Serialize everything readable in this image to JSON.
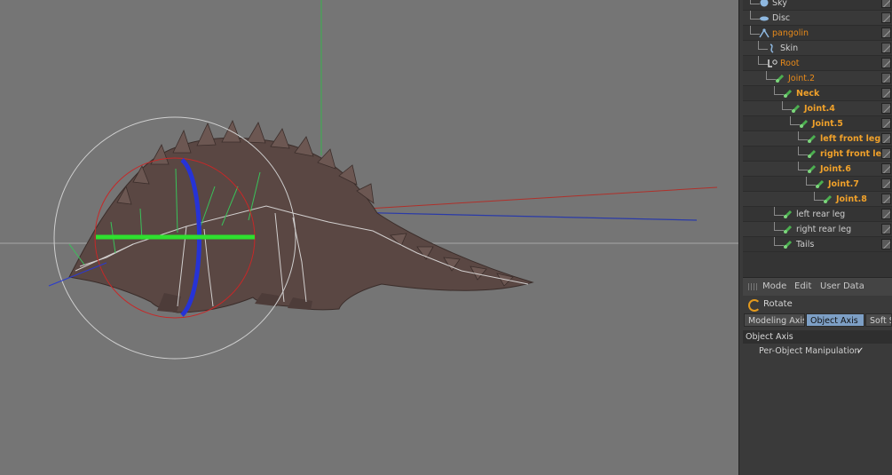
{
  "object_manager": {
    "items": [
      {
        "label": "Sky",
        "icon": "sky-icon",
        "style": "normal",
        "indent": 0
      },
      {
        "label": "Disc",
        "icon": "disc-icon",
        "style": "normal",
        "indent": 0
      },
      {
        "label": "pangolin",
        "icon": "figure-icon",
        "style": "orange",
        "indent": 0
      },
      {
        "label": "Skin",
        "icon": "skin-icon",
        "style": "normal",
        "indent": 1
      },
      {
        "label": "Root",
        "icon": "root-joint-icon",
        "style": "orange",
        "indent": 1
      },
      {
        "label": "Joint.2",
        "icon": "joint-icon",
        "style": "orange",
        "indent": 2
      },
      {
        "label": "Neck",
        "icon": "joint-icon",
        "style": "orange-bold",
        "indent": 3
      },
      {
        "label": "Joint.4",
        "icon": "joint-icon",
        "style": "orange-bold",
        "indent": 4
      },
      {
        "label": "Joint.5",
        "icon": "joint-icon",
        "style": "orange-bold",
        "indent": 5
      },
      {
        "label": "left front leg",
        "icon": "joint-icon",
        "style": "orange-bold",
        "indent": 6
      },
      {
        "label": "right front leg",
        "icon": "joint-icon",
        "style": "orange-bold",
        "indent": 6
      },
      {
        "label": "Joint.6",
        "icon": "joint-icon",
        "style": "orange-bold",
        "indent": 6
      },
      {
        "label": "Joint.7",
        "icon": "joint-icon",
        "style": "orange-bold",
        "indent": 7
      },
      {
        "label": "Joint.8",
        "icon": "joint-icon",
        "style": "orange-bold",
        "indent": 8
      },
      {
        "label": "left rear leg",
        "icon": "joint-icon",
        "style": "normal",
        "indent": 3
      },
      {
        "label": "right rear leg",
        "icon": "joint-icon",
        "style": "normal",
        "indent": 3
      },
      {
        "label": "Tails",
        "icon": "joint-icon",
        "style": "normal",
        "indent": 3
      }
    ]
  },
  "attributes": {
    "menu": [
      "Mode",
      "Edit",
      "User Data"
    ],
    "tool": "Rotate",
    "tabs": [
      "Modeling Axis",
      "Object Axis",
      "Soft S"
    ],
    "active_tab": "Object Axis",
    "section_title": "Object Axis",
    "option_label": "Per-Object Manipulation",
    "option_checked": true,
    "check_glyph": "✓"
  },
  "colors": {
    "viewport_bg": "#757575",
    "selected_orange": "#e88a1a",
    "active_tab": "#7d9fc5",
    "axis_x": "#c0392b",
    "axis_y": "#27ae60",
    "axis_z": "#2c3e9e"
  }
}
